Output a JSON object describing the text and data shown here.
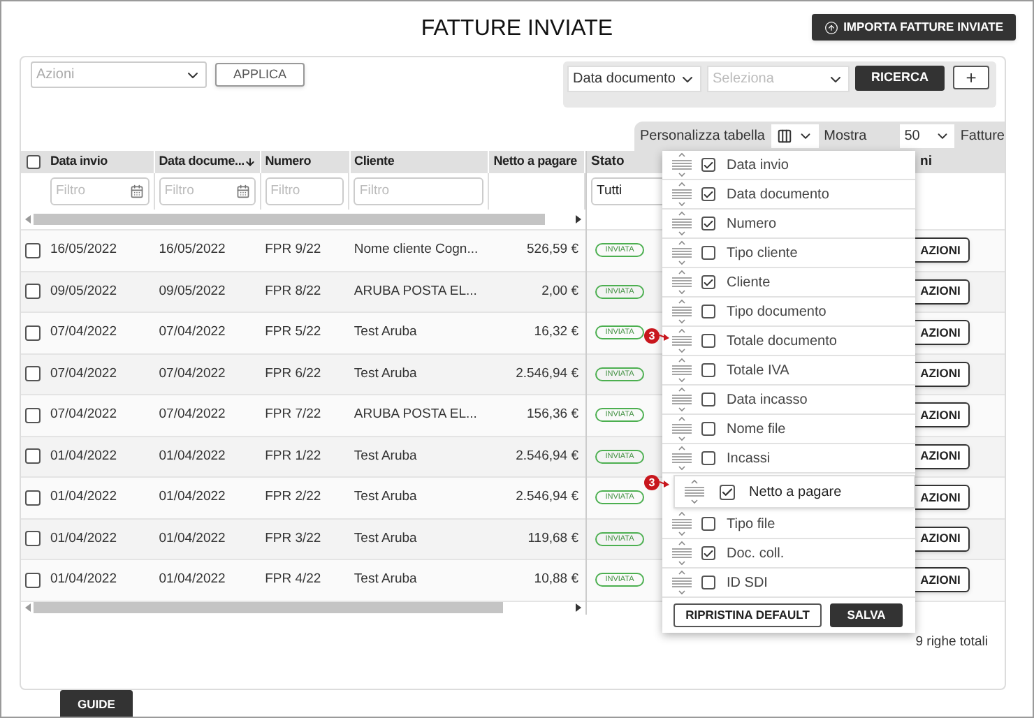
{
  "page": {
    "title": "FATTURE INVIATE",
    "import_button": "IMPORTA FATTURE INVIATE"
  },
  "toolbar": {
    "actions_select": {
      "placeholder": "Azioni"
    },
    "apply_button": "APPLICA",
    "date_field_select": "Data documento",
    "period_select": {
      "placeholder": "Seleziona"
    },
    "search_button": "RICERCA",
    "add_button": "+"
  },
  "table_options": {
    "customize_label": "Personalizza tabella",
    "show_label": "Mostra",
    "page_size": "50",
    "suffix": "Fatture"
  },
  "table": {
    "select_all_checked": false,
    "columns": [
      {
        "label": "Data invio",
        "filter": {
          "kind": "date",
          "placeholder": "Filtro"
        },
        "sorted": false
      },
      {
        "label": "Data docume...",
        "filter": {
          "kind": "date",
          "placeholder": "Filtro"
        },
        "sorted": true
      },
      {
        "label": "Numero",
        "filter": {
          "kind": "text",
          "placeholder": "Filtro"
        },
        "sorted": false
      },
      {
        "label": "Cliente",
        "filter": {
          "kind": "text",
          "placeholder": "Filtro"
        },
        "sorted": false
      },
      {
        "label": "Netto a pagare",
        "sorted": false
      }
    ],
    "status_column": {
      "label": "Stato",
      "filter_value": "Tutti"
    },
    "column_7": {
      "label": "ni"
    },
    "rows": [
      {
        "checked": false,
        "date_sent": "16/05/2022",
        "date_doc": "16/05/2022",
        "number": "FPR 9/22",
        "client": "Nome cliente Cogn...",
        "net": "526,59 €",
        "status": "INVIATA",
        "action": "AZIONI"
      },
      {
        "checked": false,
        "date_sent": "09/05/2022",
        "date_doc": "09/05/2022",
        "number": "FPR 8/22",
        "client": "ARUBA POSTA EL...",
        "net": "2,00 €",
        "status": "INVIATA",
        "action": "AZIONI"
      },
      {
        "checked": false,
        "date_sent": "07/04/2022",
        "date_doc": "07/04/2022",
        "number": "FPR 5/22",
        "client": "Test Aruba",
        "net": "16,32 €",
        "status": "INVIATA",
        "action": "AZIONI"
      },
      {
        "checked": false,
        "date_sent": "07/04/2022",
        "date_doc": "07/04/2022",
        "number": "FPR 6/22",
        "client": "Test Aruba",
        "net": "2.546,94 €",
        "status": "INVIATA",
        "action": "AZIONI"
      },
      {
        "checked": false,
        "date_sent": "07/04/2022",
        "date_doc": "07/04/2022",
        "number": "FPR 7/22",
        "client": "ARUBA POSTA EL...",
        "net": "156,36 €",
        "status": "INVIATA",
        "action": "AZIONI"
      },
      {
        "checked": false,
        "date_sent": "01/04/2022",
        "date_doc": "01/04/2022",
        "number": "FPR 1/22",
        "client": "Test Aruba",
        "net": "2.546,94 €",
        "status": "INVIATA",
        "action": "AZIONI"
      },
      {
        "checked": false,
        "date_sent": "01/04/2022",
        "date_doc": "01/04/2022",
        "number": "FPR 2/22",
        "client": "Test Aruba",
        "net": "2.546,94 €",
        "status": "INVIATA",
        "action": "AZIONI"
      },
      {
        "checked": false,
        "date_sent": "01/04/2022",
        "date_doc": "01/04/2022",
        "number": "FPR 3/22",
        "client": "Test Aruba",
        "net": "119,68 €",
        "status": "INVIATA",
        "action": "AZIONI"
      },
      {
        "checked": false,
        "date_sent": "01/04/2022",
        "date_doc": "01/04/2022",
        "number": "FPR 4/22",
        "client": "Test Aruba",
        "net": "10,88 €",
        "status": "INVIATA",
        "action": "AZIONI"
      }
    ],
    "total": "9 righe totali"
  },
  "column_picker": {
    "items": [
      {
        "label": "Data invio",
        "checked": true,
        "kind": "item"
      },
      {
        "label": "Data documento",
        "checked": true,
        "kind": "item"
      },
      {
        "label": "Numero",
        "checked": true,
        "kind": "item"
      },
      {
        "label": "Tipo cliente",
        "checked": false,
        "kind": "item"
      },
      {
        "label": "Cliente",
        "checked": true,
        "kind": "item"
      },
      {
        "label": "Tipo documento",
        "checked": false,
        "kind": "item"
      },
      {
        "label": "Totale documento",
        "checked": false,
        "kind": "item",
        "marker": "3"
      },
      {
        "label": "Totale IVA",
        "checked": false,
        "kind": "item"
      },
      {
        "label": "Data incasso",
        "checked": false,
        "kind": "item"
      },
      {
        "label": "Nome file",
        "checked": false,
        "kind": "item"
      },
      {
        "label": "Incassi",
        "checked": false,
        "kind": "item"
      },
      {
        "label": "Netto a pagare",
        "checked": true,
        "kind": "dragging",
        "marker": "3"
      },
      {
        "label": "Tipo file",
        "checked": false,
        "kind": "item"
      },
      {
        "label": "Doc. coll.",
        "checked": true,
        "kind": "item"
      },
      {
        "label": "ID SDI",
        "checked": false,
        "kind": "item"
      }
    ],
    "reset_button": "RIPRISTINA DEFAULT",
    "save_button": "SALVA"
  },
  "guide_tab": "GUIDE"
}
